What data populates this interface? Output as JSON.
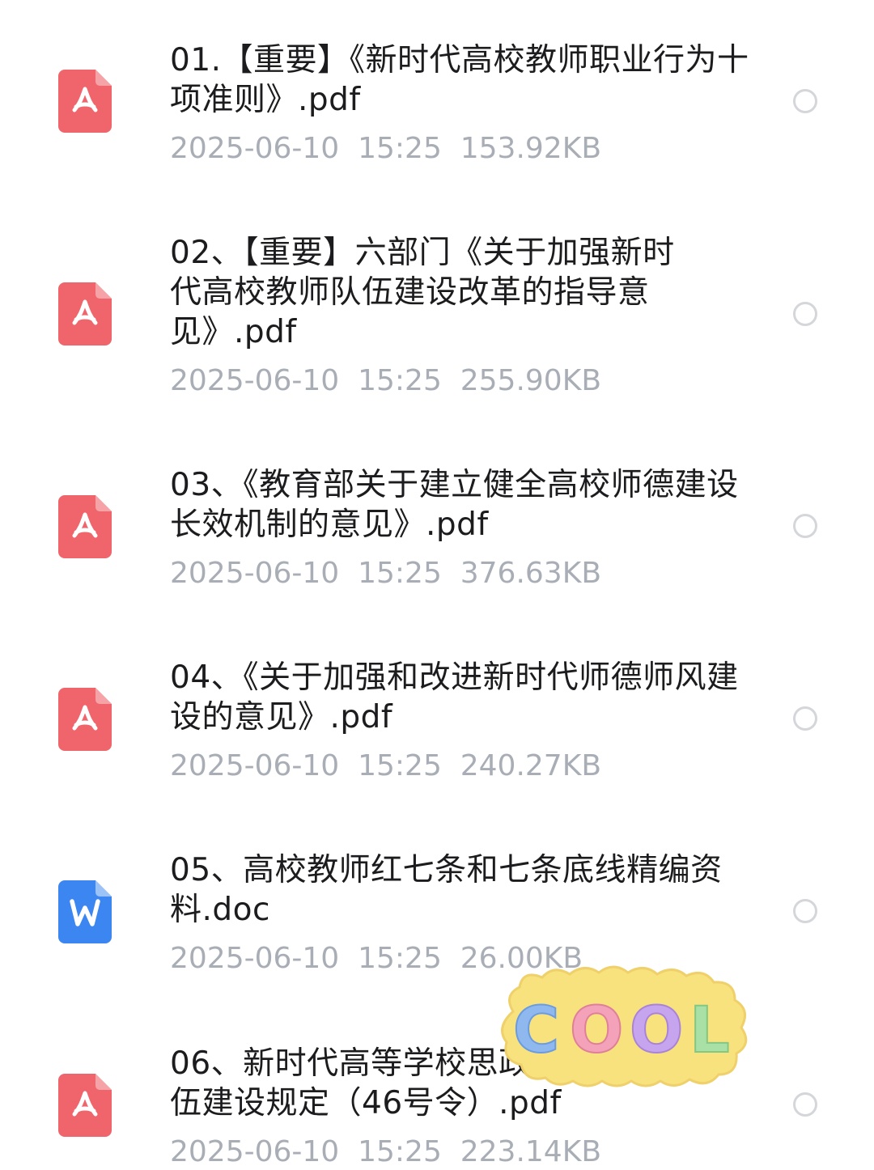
{
  "files": [
    {
      "name": "01.【重要】《新时代高校教师职业行为十项准则》.pdf",
      "date": "2025-06-10",
      "time": "15:25",
      "size": "153.92KB",
      "type": "pdf"
    },
    {
      "name": "02、【重要】六部门《关于加强新时代高校教师队伍建设改革的指导意见》.pdf",
      "date": "2025-06-10",
      "time": "15:25",
      "size": "255.90KB",
      "type": "pdf"
    },
    {
      "name": "03、《教育部关于建立健全高校师德建设长效机制的意见》.pdf",
      "date": "2025-06-10",
      "time": "15:25",
      "size": "376.63KB",
      "type": "pdf"
    },
    {
      "name": "04、《关于加强和改进新时代师德师风建设的意见》.pdf",
      "date": "2025-06-10",
      "time": "15:25",
      "size": "240.27KB",
      "type": "pdf"
    },
    {
      "name": "05、高校教师红七条和七条底线精编资料.doc",
      "date": "2025-06-10",
      "time": "15:25",
      "size": "26.00KB",
      "type": "doc"
    },
    {
      "name": "06、新时代高等学校思政课教师队伍建设规定（46号令）.pdf",
      "date": "2025-06-10",
      "time": "15:25",
      "size": "223.14KB",
      "type": "pdf"
    }
  ],
  "sticker": {
    "text": "COOL",
    "bg_color": "#f7e27e",
    "letter_colors": [
      "#8fb8ef",
      "#f3a2b9",
      "#c7a5ee",
      "#a8e0a6"
    ]
  },
  "colors": {
    "pdf_icon": "#f0646b",
    "doc_icon": "#3b86f0",
    "name_text": "#1c1c1e",
    "meta_text": "#a9aeb6",
    "radio_border": "#d4d6da"
  },
  "icons": {
    "pdf": "pdf-file-icon",
    "doc": "word-doc-icon",
    "select": "radio-unchecked-icon"
  }
}
